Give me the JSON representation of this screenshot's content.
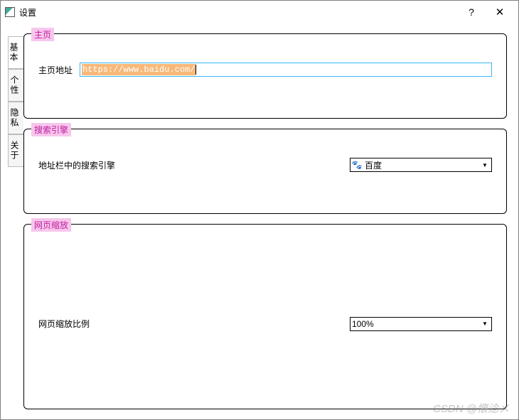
{
  "window": {
    "title": "设置",
    "help": "?",
    "close": "✕"
  },
  "tabs": {
    "items": [
      {
        "label": "基本"
      },
      {
        "label": "个性"
      },
      {
        "label": "隐私"
      },
      {
        "label": "关于"
      }
    ]
  },
  "groups": {
    "homepage": {
      "legend": "主页",
      "label": "主页地址",
      "value": "https://www.baidu.com/"
    },
    "search": {
      "legend": "搜索引擎",
      "label": "地址栏中的搜索引擎",
      "selected": "百度",
      "icon_glyph": "🐾"
    },
    "zoom": {
      "legend": "网页缩放",
      "label": "网页缩放比例",
      "selected": "100%"
    }
  },
  "watermark": "CSDN @懐淰メ"
}
